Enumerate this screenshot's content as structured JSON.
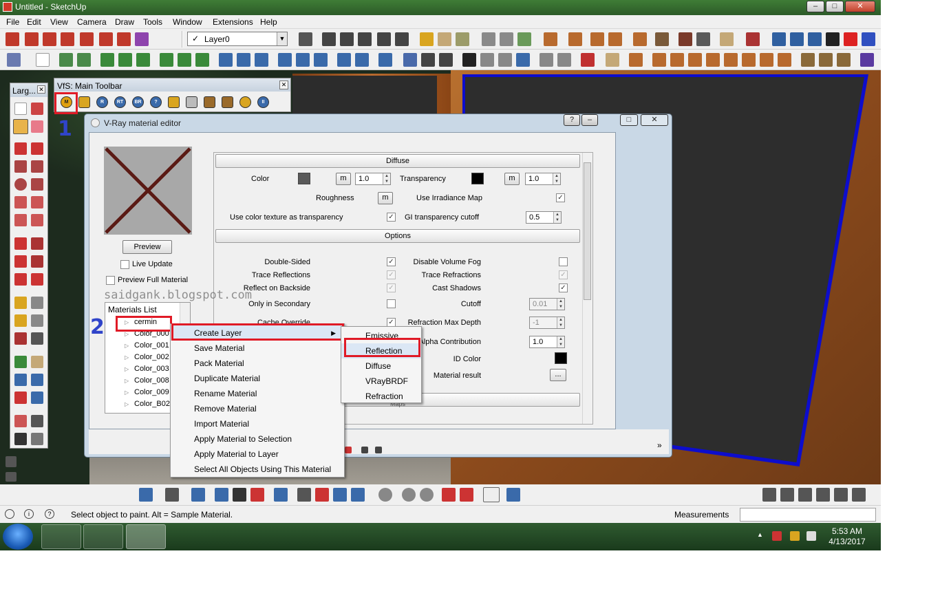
{
  "window": {
    "title": "Untitled - SketchUp",
    "minimize": "–",
    "maximize": "□",
    "close": "✕"
  },
  "menubar": [
    "File",
    "Edit",
    "View",
    "Camera",
    "Draw",
    "Tools",
    "Window",
    "Extensions",
    "Help"
  ],
  "layer_combo": {
    "check": "✓",
    "value": "Layer0",
    "arrow": "▼"
  },
  "large_tool_set": {
    "title": "Larg...",
    "close": "✕"
  },
  "vfs_toolbar": {
    "title": "VfS: Main Toolbar",
    "close": "✕",
    "buttons": [
      "M",
      "",
      "R",
      "RT",
      "BR",
      "?",
      "",
      "",
      "",
      "",
      "",
      "II"
    ]
  },
  "vray_editor": {
    "title": "V-Ray material editor",
    "help": "?",
    "minimize": "–",
    "maximize": "□",
    "close": "✕",
    "preview_button": "Preview",
    "live_update": "Live Update",
    "preview_full": "Preview Full Material",
    "materials_list": {
      "header": "Materials List",
      "items": [
        "cermin",
        "Color_000",
        "Color_001",
        "Color_002",
        "Color_003",
        "Color_008",
        "Color_009",
        "Color_B02"
      ]
    },
    "diffuse": {
      "header": "Diffuse",
      "color_label": "Color",
      "color_swatch": "#5a5a5a",
      "color_amount": "1.0",
      "transparency_label": "Transparency",
      "transparency_swatch": "#000000",
      "transparency_amount": "1.0",
      "map_button": "m",
      "roughness_label": "Roughness",
      "use_irradiance_map": "Use Irradiance Map",
      "use_color_texture": "Use color texture as transparency",
      "gi_transparency_cutoff": "GI transparency cutoff",
      "gi_cutoff_value": "0.5"
    },
    "options": {
      "header": "Options",
      "left": [
        "Double-Sided",
        "Trace Reflections",
        "Reflect on Backside",
        "Only in Secondary",
        "Cache Override"
      ],
      "right": [
        "Disable Volume Fog",
        "Trace Refractions",
        "Cast Shadows",
        "Cutoff",
        "Refraction Max Depth",
        "Alpha Contribution",
        "ID Color",
        "Material result"
      ],
      "cutoff_value": "0.01",
      "refraction_depth_value": "-1",
      "alpha_value": "1.0",
      "id_color_swatch": "#000000",
      "material_result_button": "..."
    },
    "next_section_partial": "Maps",
    "bottom_toggle": "»"
  },
  "context_menu": {
    "items": [
      "Create Layer",
      "Save Material",
      "Pack Material",
      "Duplicate Material",
      "Rename Material",
      "Remove Material",
      "Import Material",
      "Apply Material to Selection",
      "Apply Material to Layer",
      "Select All Objects Using This Material"
    ],
    "submenu_arrow": "▶"
  },
  "layer_submenu": {
    "items": [
      "Emissive",
      "Reflection",
      "Diffuse",
      "VRayBRDF",
      "Refraction"
    ]
  },
  "annotations": {
    "step1": "1",
    "step2": "2",
    "watermark": "saidgank.blogspot.com"
  },
  "status": {
    "message": "Select object to paint. Alt = Sample Material.",
    "measurements": "Measurements",
    "info": "i",
    "help": "?"
  },
  "taskbar": {
    "time": "5:53 AM",
    "date": "4/13/2017",
    "tray_up": "▲"
  },
  "colors": {
    "red_highlight": "#e01a26",
    "annotation_blue": "#3044c9",
    "board_outline": "#0d0dcc"
  }
}
